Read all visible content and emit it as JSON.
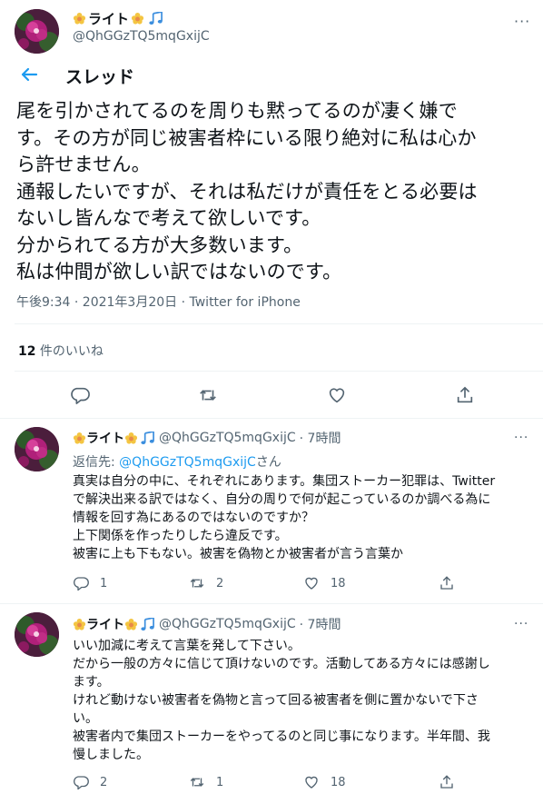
{
  "top_author": {
    "name": "ライト",
    "handle": "@QhGGzTQ5mqGxijC",
    "more": "···"
  },
  "header": {
    "title": "スレッド"
  },
  "main_tweet": {
    "text": "尾を引かされてるのを周りも黙ってるのが凄く嫌で\nす。その方が同じ被害者枠にいる限り絶対に私は心か\nら許せません。\n通報したいですが、それは私だけが責任をとる必要は\nないし皆んなで考えて欲しいです。\n分かられてる方が大多数います。\n私は仲間が欲しい訳ではないのです。",
    "meta": "午後9:34 · 2021年3月20日 · Twitter for iPhone",
    "likes_count": "12",
    "likes_label": " 件のいいね"
  },
  "replies": [
    {
      "name": "ライト",
      "handle": "@QhGGzTQ5mqGxijC",
      "time": "· 7時間",
      "reply_prefix": "返信先: ",
      "reply_mention": "@QhGGzTQ5mqGxijC",
      "reply_suffix": "さん",
      "text": "真実は自分の中に、それぞれにあります。集団ストーカー犯罪は、Twitter\nで解決出来る訳ではなく、自分の周りで何が起こっているのか調べる為に\n情報を回す為にあるのではないのですか？\n上下関係を作ったりしたら違反です。\n被害に上も下もない。被害を偽物とか被害者が言う言葉か",
      "reply_count": "1",
      "retweet_count": "2",
      "like_count": "18"
    },
    {
      "name": "ライト",
      "handle": "@QhGGzTQ5mqGxijC",
      "time": "· 7時間",
      "text": "いい加減に考えて言葉を発して下さい。\nだから一般の方々に信じて頂けないのです。活動してある方々には感謝し\nます。\nけれど動けない被害者を偽物と言って回る被害者を側に置かないで下さ\nい。\n被害者内で集団ストーカーをやってるのと同じ事になります。半年間、我\n慢しました。",
      "reply_count": "2",
      "retweet_count": "1",
      "like_count": "18"
    }
  ],
  "colors": {
    "accent": "#1d9bf0",
    "muted": "#536471",
    "text": "#0f1419",
    "divider": "#eff3f4"
  }
}
